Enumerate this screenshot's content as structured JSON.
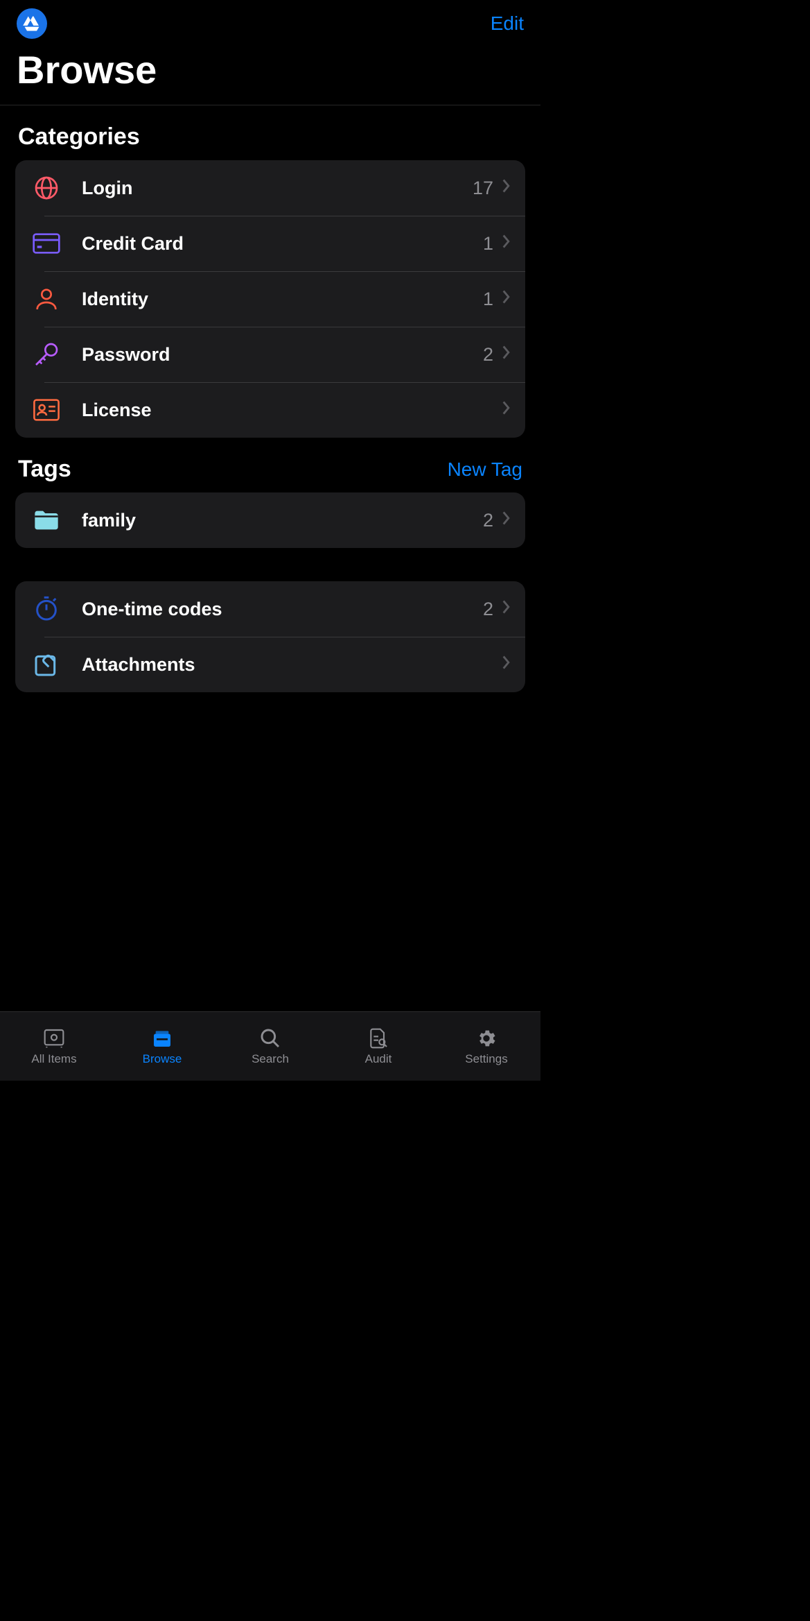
{
  "header": {
    "edit": "Edit",
    "title": "Browse"
  },
  "categories": {
    "title": "Categories",
    "items": [
      {
        "label": "Login",
        "count": "17"
      },
      {
        "label": "Credit Card",
        "count": "1"
      },
      {
        "label": "Identity",
        "count": "1"
      },
      {
        "label": "Password",
        "count": "2"
      },
      {
        "label": "License",
        "count": ""
      }
    ]
  },
  "tags": {
    "title": "Tags",
    "action": "New Tag",
    "items": [
      {
        "label": "family",
        "count": "2"
      }
    ]
  },
  "utilities": {
    "items": [
      {
        "label": "One-time codes",
        "count": "2"
      },
      {
        "label": "Attachments",
        "count": ""
      }
    ]
  },
  "tabbar": {
    "items": [
      {
        "label": "All Items"
      },
      {
        "label": "Browse"
      },
      {
        "label": "Search"
      },
      {
        "label": "Audit"
      },
      {
        "label": "Settings"
      }
    ]
  }
}
